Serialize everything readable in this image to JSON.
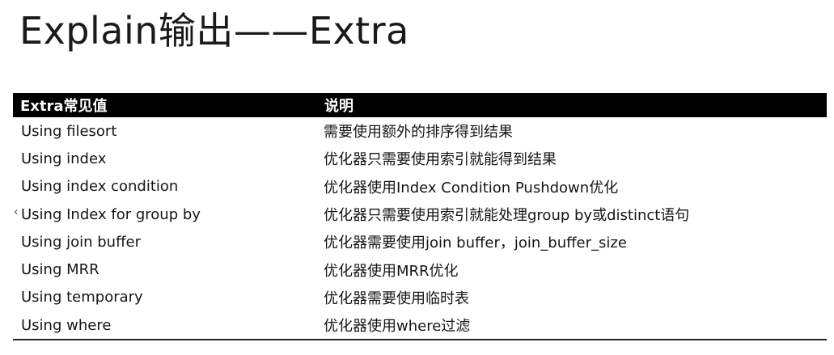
{
  "title": "Explain输出——Extra",
  "table": {
    "headers": [
      "Extra常见值",
      "说明"
    ],
    "rows": [
      {
        "value": "Using filesort",
        "desc": "需要使用额外的排序得到结果"
      },
      {
        "value": "Using index",
        "desc": "优化器只需要使用索引就能得到结果"
      },
      {
        "value": "Using index condition",
        "desc": "优化器使用Index Condition Pushdown优化"
      },
      {
        "value": "Using Index for group by",
        "desc": "优化器只需要使用索引就能处理group by或distinct语句"
      },
      {
        "value": "Using join buffer",
        "desc": "优化器需要使用join buffer，join_buffer_size"
      },
      {
        "value": "Using MRR",
        "desc": "优化器使用MRR优化"
      },
      {
        "value": "Using temporary",
        "desc": "优化器需要使用临时表"
      },
      {
        "value": "Using where",
        "desc": "优化器使用where过滤"
      }
    ]
  }
}
